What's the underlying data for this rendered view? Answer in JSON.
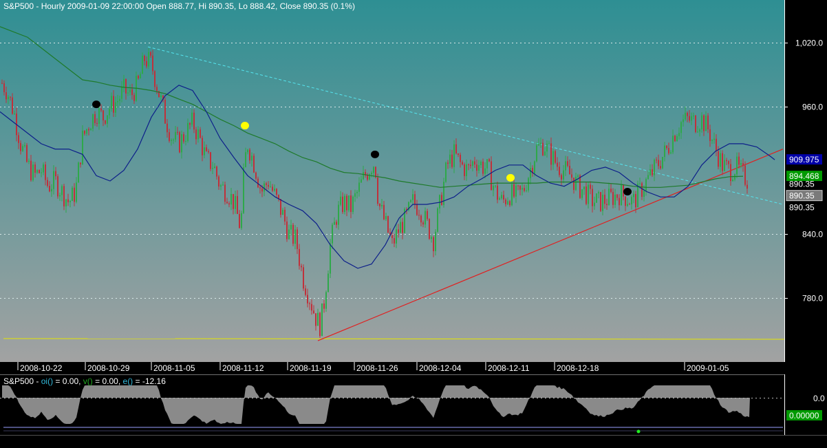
{
  "header": {
    "title": "S&P500 - Hourly 2009-01-09 22:00:00 Open 888.77, Hi 890.35, Lo 888.42, Close 890.35 (0.1%)"
  },
  "colors": {
    "price_bg_top": "#2e8f93",
    "price_bg_bottom": "#a2a2a2",
    "up_candle": "#2ea84a",
    "down_candle": "#c0303a",
    "ma_blue": "#0d1f8a",
    "ma_green": "#1e7a2a",
    "support_red": "#e02020",
    "resistance_cyan": "#55e6f0",
    "horizontal_yellow": "#e6e600",
    "marker_black": "#000000",
    "marker_yellow": "#ffff00",
    "tag_blue": "#0000a8",
    "tag_green": "#009a00",
    "tag_gray": "#7a7a7a",
    "osc_fill": "#8a8a8a",
    "osc_line": "#9aa0ff"
  },
  "chart_data": [
    {
      "type": "candlestick",
      "title": "S&P500 - Hourly 2009-01-09 22:00:00 Open 888.77, Hi 890.35, Lo 888.42, Close 890.35 (0.1%)",
      "y_ticks": [
        "1,020.0",
        "960.0",
        "840.0",
        "780.0"
      ],
      "ylim": [
        720,
        1060
      ],
      "x_ticks": [
        "2008-10-22",
        "2008-10-29",
        "2008-11-05",
        "2008-11-12",
        "2008-11-19",
        "2008-11-26",
        "2008-12-04",
        "2008-12-11",
        "2008-12-18",
        "2009-01-05"
      ],
      "last": {
        "open": 888.77,
        "high": 890.35,
        "low": 888.42,
        "close": 890.35,
        "change_pct": "0.1%"
      },
      "price_path": [
        [
          0,
          985
        ],
        [
          10,
          975
        ],
        [
          20,
          955
        ],
        [
          30,
          925
        ],
        [
          40,
          905
        ],
        [
          50,
          895
        ],
        [
          60,
          900
        ],
        [
          70,
          885
        ],
        [
          80,
          890
        ],
        [
          90,
          880
        ],
        [
          100,
          870
        ],
        [
          110,
          880
        ],
        [
          120,
          930
        ],
        [
          130,
          945
        ],
        [
          140,
          955
        ],
        [
          150,
          950
        ],
        [
          160,
          960
        ],
        [
          170,
          965
        ],
        [
          180,
          975
        ],
        [
          190,
          970
        ],
        [
          200,
          980
        ],
        [
          210,
          1005
        ],
        [
          220,
          1000
        ],
        [
          230,
          975
        ],
        [
          240,
          950
        ],
        [
          250,
          930
        ],
        [
          260,
          925
        ],
        [
          270,
          935
        ],
        [
          280,
          945
        ],
        [
          290,
          930
        ],
        [
          300,
          910
        ],
        [
          310,
          905
        ],
        [
          320,
          885
        ],
        [
          330,
          880
        ],
        [
          340,
          870
        ],
        [
          350,
          845
        ],
        [
          355,
          905
        ],
        [
          360,
          925
        ],
        [
          370,
          905
        ],
        [
          380,
          880
        ],
        [
          390,
          890
        ],
        [
          400,
          875
        ],
        [
          410,
          860
        ],
        [
          420,
          840
        ],
        [
          430,
          835
        ],
        [
          440,
          800
        ],
        [
          450,
          780
        ],
        [
          460,
          760
        ],
        [
          465,
          755
        ],
        [
          470,
          770
        ],
        [
          480,
          830
        ],
        [
          490,
          860
        ],
        [
          500,
          870
        ],
        [
          510,
          865
        ],
        [
          520,
          880
        ],
        [
          530,
          895
        ],
        [
          540,
          905
        ],
        [
          545,
          908
        ],
        [
          550,
          870
        ],
        [
          560,
          850
        ],
        [
          570,
          830
        ],
        [
          580,
          845
        ],
        [
          590,
          855
        ],
        [
          600,
          870
        ],
        [
          610,
          865
        ],
        [
          620,
          850
        ],
        [
          630,
          835
        ],
        [
          640,
          870
        ],
        [
          650,
          905
        ],
        [
          660,
          915
        ],
        [
          670,
          905
        ],
        [
          680,
          900
        ],
        [
          690,
          910
        ],
        [
          700,
          905
        ],
        [
          710,
          900
        ],
        [
          720,
          880
        ],
        [
          730,
          870
        ],
        [
          740,
          878
        ],
        [
          750,
          875
        ],
        [
          760,
          880
        ],
        [
          770,
          900
        ],
        [
          780,
          920
        ],
        [
          790,
          925
        ],
        [
          800,
          915
        ],
        [
          810,
          905
        ],
        [
          820,
          900
        ],
        [
          830,
          895
        ],
        [
          840,
          885
        ],
        [
          850,
          880
        ],
        [
          860,
          872
        ],
        [
          870,
          870
        ],
        [
          880,
          872
        ],
        [
          890,
          875
        ],
        [
          900,
          878
        ],
        [
          910,
          875
        ],
        [
          920,
          870
        ],
        [
          930,
          880
        ],
        [
          940,
          890
        ],
        [
          950,
          900
        ],
        [
          960,
          910
        ],
        [
          970,
          920
        ],
        [
          980,
          935
        ],
        [
          990,
          945
        ],
        [
          1000,
          948
        ],
        [
          1010,
          945
        ],
        [
          1020,
          948
        ],
        [
          1030,
          938
        ],
        [
          1040,
          920
        ],
        [
          1050,
          905
        ],
        [
          1060,
          900
        ],
        [
          1070,
          903
        ],
        [
          1080,
          895
        ],
        [
          1088,
          890.35
        ]
      ],
      "blue_ma_path": [
        [
          0,
          955
        ],
        [
          20,
          945
        ],
        [
          40,
          935
        ],
        [
          60,
          925
        ],
        [
          80,
          920
        ],
        [
          100,
          920
        ],
        [
          120,
          915
        ],
        [
          140,
          895
        ],
        [
          160,
          890
        ],
        [
          180,
          900
        ],
        [
          200,
          920
        ],
        [
          220,
          950
        ],
        [
          240,
          970
        ],
        [
          260,
          980
        ],
        [
          280,
          975
        ],
        [
          300,
          955
        ],
        [
          320,
          930
        ],
        [
          340,
          912
        ],
        [
          360,
          895
        ],
        [
          380,
          885
        ],
        [
          400,
          875
        ],
        [
          420,
          868
        ],
        [
          440,
          862
        ],
        [
          460,
          850
        ],
        [
          480,
          830
        ],
        [
          500,
          815
        ],
        [
          520,
          808
        ],
        [
          540,
          812
        ],
        [
          560,
          830
        ],
        [
          580,
          855
        ],
        [
          600,
          868
        ],
        [
          620,
          868
        ],
        [
          640,
          870
        ],
        [
          660,
          875
        ],
        [
          680,
          885
        ],
        [
          700,
          892
        ],
        [
          720,
          900
        ],
        [
          740,
          905
        ],
        [
          760,
          905
        ],
        [
          780,
          895
        ],
        [
          800,
          888
        ],
        [
          820,
          885
        ],
        [
          840,
          892
        ],
        [
          860,
          900
        ],
        [
          880,
          903
        ],
        [
          900,
          898
        ],
        [
          920,
          888
        ],
        [
          940,
          880
        ],
        [
          960,
          875
        ],
        [
          980,
          875
        ],
        [
          1000,
          885
        ],
        [
          1020,
          905
        ],
        [
          1040,
          918
        ],
        [
          1060,
          925
        ],
        [
          1080,
          925
        ],
        [
          1100,
          922
        ],
        [
          1120,
          913
        ],
        [
          1126,
          909.975
        ]
      ],
      "green_ma_path": [
        [
          0,
          1035
        ],
        [
          20,
          1030
        ],
        [
          40,
          1025
        ],
        [
          60,
          1015
        ],
        [
          80,
          1005
        ],
        [
          100,
          995
        ],
        [
          120,
          985
        ],
        [
          140,
          983
        ],
        [
          160,
          980
        ],
        [
          180,
          978
        ],
        [
          200,
          977
        ],
        [
          220,
          975
        ],
        [
          240,
          972
        ],
        [
          260,
          967
        ],
        [
          280,
          962
        ],
        [
          300,
          955
        ],
        [
          320,
          948
        ],
        [
          340,
          942
        ],
        [
          360,
          935
        ],
        [
          380,
          930
        ],
        [
          400,
          925
        ],
        [
          420,
          918
        ],
        [
          440,
          912
        ],
        [
          460,
          908
        ],
        [
          480,
          902
        ],
        [
          500,
          898
        ],
        [
          520,
          897
        ],
        [
          540,
          895
        ],
        [
          560,
          893
        ],
        [
          580,
          890
        ],
        [
          600,
          888
        ],
        [
          620,
          886
        ],
        [
          640,
          884
        ],
        [
          660,
          885
        ],
        [
          680,
          886
        ],
        [
          700,
          887
        ],
        [
          720,
          888
        ],
        [
          740,
          888
        ],
        [
          760,
          888
        ],
        [
          780,
          888
        ],
        [
          800,
          889
        ],
        [
          820,
          889
        ],
        [
          840,
          889
        ],
        [
          860,
          889
        ],
        [
          880,
          888
        ],
        [
          900,
          887
        ],
        [
          920,
          885
        ],
        [
          940,
          884
        ],
        [
          960,
          884
        ],
        [
          980,
          885
        ],
        [
          1000,
          886
        ],
        [
          1020,
          889
        ],
        [
          1040,
          892
        ],
        [
          1060,
          894
        ],
        [
          1080,
          894.468
        ]
      ],
      "black_markers": [
        [
          140,
          962
        ],
        [
          545,
          915
        ],
        [
          912,
          880
        ]
      ],
      "yellow_markers": [
        [
          356,
          942
        ],
        [
          742,
          893
        ]
      ],
      "trendline_support": {
        "from": [
          462,
          740
        ],
        "to": [
          1138,
          920
        ]
      },
      "trendline_resistance": {
        "from": [
          215,
          1016
        ],
        "to": [
          1138,
          868
        ]
      },
      "horizontal_line": 742,
      "price_tags": [
        {
          "label": "909.975",
          "value": 909.975,
          "style": "blue"
        },
        {
          "label": "894.468",
          "value": 894.468,
          "style": "green"
        },
        {
          "label": "890.35",
          "value": 887,
          "style": "plain"
        },
        {
          "label": "890.35",
          "value": 876,
          "style": "gray"
        },
        {
          "label": "890.35",
          "value": 865,
          "style": "plain"
        }
      ]
    },
    {
      "type": "area",
      "title": "S&P500 - oi() = 0.00, v() = 0.00, e() = -12.16",
      "y_ticks": [
        "0.0"
      ],
      "value_tag": "0.00000"
    }
  ],
  "lower_panel": {
    "name": "S&P500",
    "sep1": " - ",
    "oi_label": "oi()",
    "oi_value": " = 0.00, ",
    "v_label": "v()",
    "v_value": " = 0.00, ",
    "e_label": "e()",
    "e_value": " = -12.16",
    "zero_label": "0.0",
    "value_tag": "0.00000"
  }
}
